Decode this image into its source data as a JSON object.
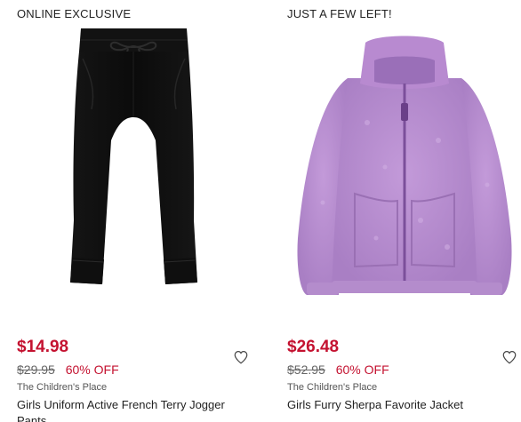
{
  "colors": {
    "sale_price": "#c41230",
    "text": "#222222",
    "strike": "#666666",
    "brand": "#555555"
  },
  "products": [
    {
      "badge": "ONLINE EXCLUSIVE",
      "price": "$14.98",
      "original_price": "$29.95",
      "discount": "60% OFF",
      "brand": "The Children's Place",
      "title": "Girls Uniform Active French Terry Jogger Pants",
      "image_icon": "black-jogger-pants-image",
      "wishlist_icon": "heart-icon"
    },
    {
      "badge": "JUST A FEW LEFT!",
      "price": "$26.48",
      "original_price": "$52.95",
      "discount": "60% OFF",
      "brand": "The Children's Place",
      "title": "Girls Furry Sherpa Favorite Jacket",
      "image_icon": "purple-sherpa-jacket-image",
      "wishlist_icon": "heart-icon"
    }
  ]
}
